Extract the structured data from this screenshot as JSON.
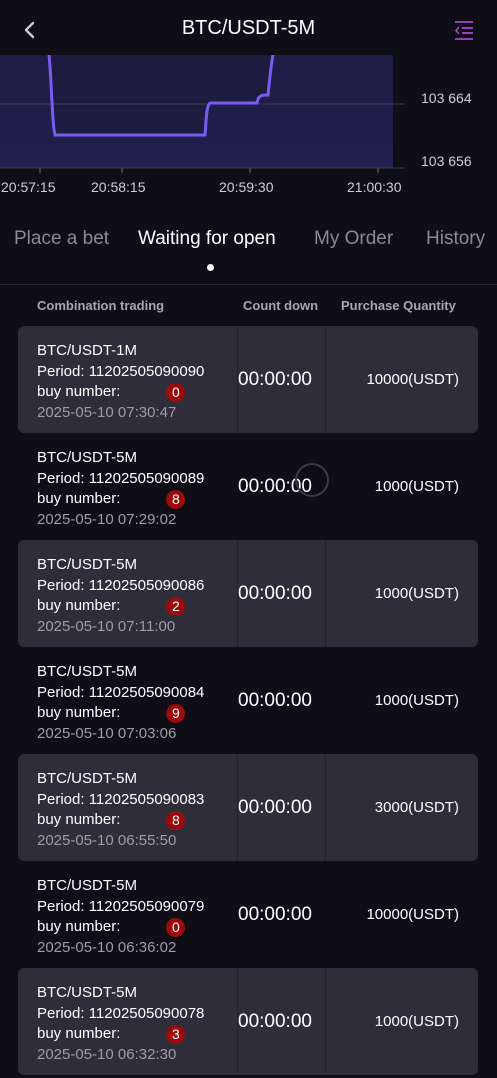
{
  "header": {
    "title": "BTC/USDT-5M"
  },
  "chart": {
    "price_labels": [
      "103 664",
      "103 656"
    ],
    "time_labels": [
      "20:57:15",
      "20:58:15",
      "20:59:30",
      "21:00:30"
    ],
    "line_color": "#7a5cf0"
  },
  "tabs": [
    {
      "label": "Place a bet",
      "active": false
    },
    {
      "label": "Waiting for open",
      "active": true
    },
    {
      "label": "My Order",
      "active": false
    },
    {
      "label": "History",
      "active": false
    }
  ],
  "columns": {
    "combination": "Combination trading",
    "countdown": "Count down",
    "quantity": "Purchase Quantity"
  },
  "orders": [
    {
      "symbol": "BTC/USDT-1M",
      "period": "Period: 11202505090090",
      "buy_label": "buy number:",
      "buy_number": "0",
      "time": "2025-05-10 07:30:47",
      "countdown": "00:00:00",
      "quantity": "10000(USDT)"
    },
    {
      "symbol": "BTC/USDT-5M",
      "period": "Period: 11202505090089",
      "buy_label": "buy number:",
      "buy_number": "8",
      "time": "2025-05-10 07:29:02",
      "countdown": "00:00:00",
      "quantity": "1000(USDT)"
    },
    {
      "symbol": "BTC/USDT-5M",
      "period": "Period: 11202505090086",
      "buy_label": "buy number:",
      "buy_number": "2",
      "time": "2025-05-10 07:11:00",
      "countdown": "00:00:00",
      "quantity": "1000(USDT)"
    },
    {
      "symbol": "BTC/USDT-5M",
      "period": "Period: 11202505090084",
      "buy_label": "buy number:",
      "buy_number": "9",
      "time": "2025-05-10 07:03:06",
      "countdown": "00:00:00",
      "quantity": "1000(USDT)"
    },
    {
      "symbol": "BTC/USDT-5M",
      "period": "Period: 11202505090083",
      "buy_label": "buy number:",
      "buy_number": "8",
      "time": "2025-05-10 06:55:50",
      "countdown": "00:00:00",
      "quantity": "3000(USDT)"
    },
    {
      "symbol": "BTC/USDT-5M",
      "period": "Period: 11202505090079",
      "buy_label": "buy number:",
      "buy_number": "0",
      "time": "2025-05-10 06:36:02",
      "countdown": "00:00:00",
      "quantity": "10000(USDT)"
    },
    {
      "symbol": "BTC/USDT-5M",
      "period": "Period: 11202505090078",
      "buy_label": "buy number:",
      "buy_number": "3",
      "time": "2025-05-10 06:32:30",
      "countdown": "00:00:00",
      "quantity": "1000(USDT)"
    }
  ]
}
